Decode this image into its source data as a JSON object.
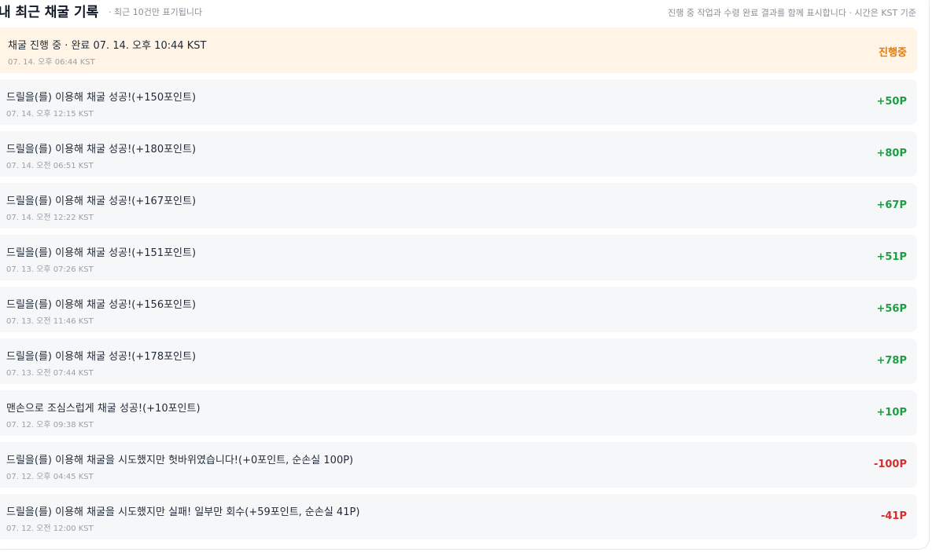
{
  "header": {
    "title": "내 최근 채굴 기록",
    "subtitle": "· 최근 10건만 표기됩니다",
    "note": "진행 중 작업과 수령 완료 결과를 함께 표시합니다 · 시간은 KST 기준"
  },
  "colors": {
    "pending_bg": "#fff4e5",
    "pending_accent": "#f0a23b",
    "pending_text": "#e07b12",
    "positive": "#1f9d45",
    "negative": "#d12f2f",
    "row_bg": "#f6f7f9"
  },
  "records": [
    {
      "status": "pending",
      "text": "채굴 진행 중 · 완료 07. 14. 오후 10:44 KST",
      "time": "07. 14. 오후 06:44 KST",
      "value": "진행중"
    },
    {
      "status": "positive",
      "text": "드릴을(를) 이용해 채굴 성공!(+150포인트)",
      "time": "07. 14. 오후 12:15 KST",
      "value": "+50P"
    },
    {
      "status": "positive",
      "text": "드릴을(를) 이용해 채굴 성공!(+180포인트)",
      "time": "07. 14. 오전 06:51 KST",
      "value": "+80P"
    },
    {
      "status": "positive",
      "text": "드릴을(를) 이용해 채굴 성공!(+167포인트)",
      "time": "07. 14. 오전 12:22 KST",
      "value": "+67P"
    },
    {
      "status": "positive",
      "text": "드릴을(를) 이용해 채굴 성공!(+151포인트)",
      "time": "07. 13. 오후 07:26 KST",
      "value": "+51P"
    },
    {
      "status": "positive",
      "text": "드릴을(를) 이용해 채굴 성공!(+156포인트)",
      "time": "07. 13. 오전 11:46 KST",
      "value": "+56P"
    },
    {
      "status": "positive",
      "text": "드릴을(를) 이용해 채굴 성공!(+178포인트)",
      "time": "07. 13. 오전 07:44 KST",
      "value": "+78P"
    },
    {
      "status": "positive",
      "text": "맨손으로 조심스럽게 채굴 성공!(+10포인트)",
      "time": "07. 12. 오후 09:38 KST",
      "value": "+10P"
    },
    {
      "status": "negative",
      "text": "드릴을(를) 이용해 채굴을 시도했지만 헛바위였습니다!(+0포인트, 순손실 100P)",
      "time": "07. 12. 오후 04:45 KST",
      "value": "-100P"
    },
    {
      "status": "negative",
      "text": "드릴을(를) 이용해 채굴을 시도했지만 실패! 일부만 회수(+59포인트, 순손실 41P)",
      "time": "07. 12. 오전 12:00 KST",
      "value": "-41P"
    }
  ]
}
